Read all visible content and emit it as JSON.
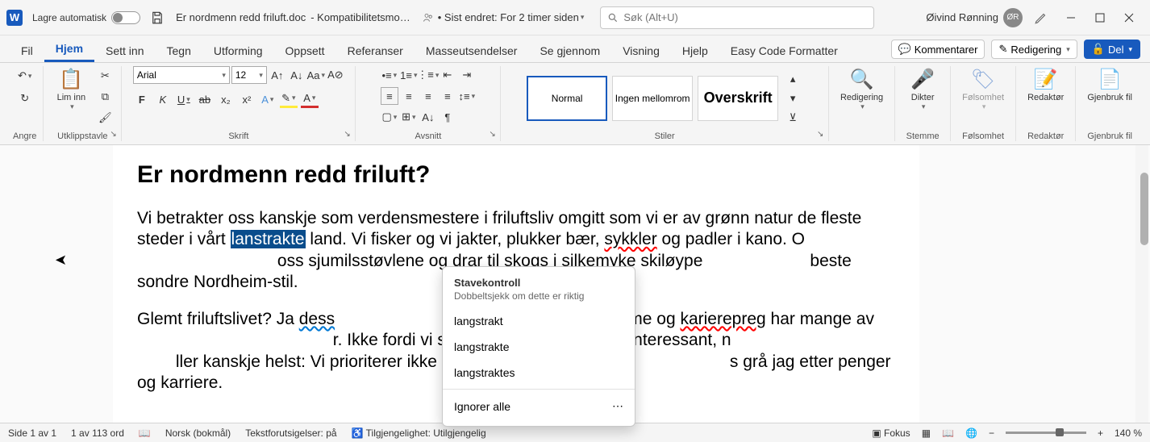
{
  "titlebar": {
    "autosave_label": "Lagre automatisk",
    "doc_title": "Er nordmenn redd friluft.doc",
    "compat": " -  Kompatibilitetsmo…",
    "last_modified": "• Sist endret: For 2 timer siden",
    "search_placeholder": "Søk (Alt+U)",
    "user_name": "Øivind Rønning",
    "user_initials": "ØR"
  },
  "tabs": {
    "items": [
      "Fil",
      "Hjem",
      "Sett inn",
      "Tegn",
      "Utforming",
      "Oppsett",
      "Referanser",
      "Masseutsendelser",
      "Se gjennom",
      "Visning",
      "Hjelp",
      "Easy Code Formatter"
    ],
    "comments": "Kommentarer",
    "editing": "Redigering",
    "share": "Del"
  },
  "ribbon": {
    "undo": "Angre",
    "clipboard": "Utklippstavle",
    "paste": "Lim inn",
    "font_group": "Skrift",
    "font_name": "Arial",
    "font_size": "12",
    "paragraph": "Avsnitt",
    "styles": "Stiler",
    "style_items": [
      "Normal",
      "Ingen mellomrom",
      "Overskrift"
    ],
    "editing_group": "Redigering",
    "dictate": "Dikter",
    "voice": "Stemme",
    "sensitivity": "Følsomhet",
    "sensitivity_group": "Følsomhet",
    "editor": "Redaktør",
    "editor_group": "Redaktør",
    "reuse": "Gjenbruk fil",
    "reuse_group": "Gjenbruk fil"
  },
  "document": {
    "heading": "Er nordmenn redd friluft?",
    "p1a": "Vi betrakter oss kanskje som verdensmestere i friluftsliv omgitt som vi er av grønn natur de fleste steder i vårt ",
    "p1_highlight": "lanstrakte",
    "p1b": " land. Vi fisker og vi jakter, plukker bær, ",
    "p1_err": "sykkler",
    "p1c": " og padler i kano. O",
    "p1d": "oss sjumilsstøvlene og drar til skogs i silkemyke skiløype",
    "p1e": "beste sondre Nordheim-stil.",
    "p2a": "Glemt friluftslivet? Ja ",
    "p2_err": "dess",
    "p2b": "et av materialisme og ",
    "p2_err2": "karierepreg",
    "p2c": " har mange av ",
    "p2d": "r. Ikke fordi vi synes det er kjedelig og uinteressant, n",
    "p2e": "ller kanskje helst: Vi prioriterer ikke frisk luft og naturopple",
    "p2f": "s grå jag etter penger og karriere."
  },
  "spellcheck": {
    "title": "Stavekontroll",
    "subtitle": "Dobbeltsjekk om dette er riktig",
    "suggestions": [
      "langstrakt",
      "langstrakte",
      "langstraktes"
    ],
    "ignore_all": "Ignorer alle"
  },
  "statusbar": {
    "page": "Side 1 av 1",
    "words": "1 av 113 ord",
    "lang": "Norsk (bokmål)",
    "predictions": "Tekstforutsigelser: på",
    "accessibility": "Tilgjengelighet: Utilgjengelig",
    "focus": "Fokus",
    "zoom": "140 %"
  }
}
